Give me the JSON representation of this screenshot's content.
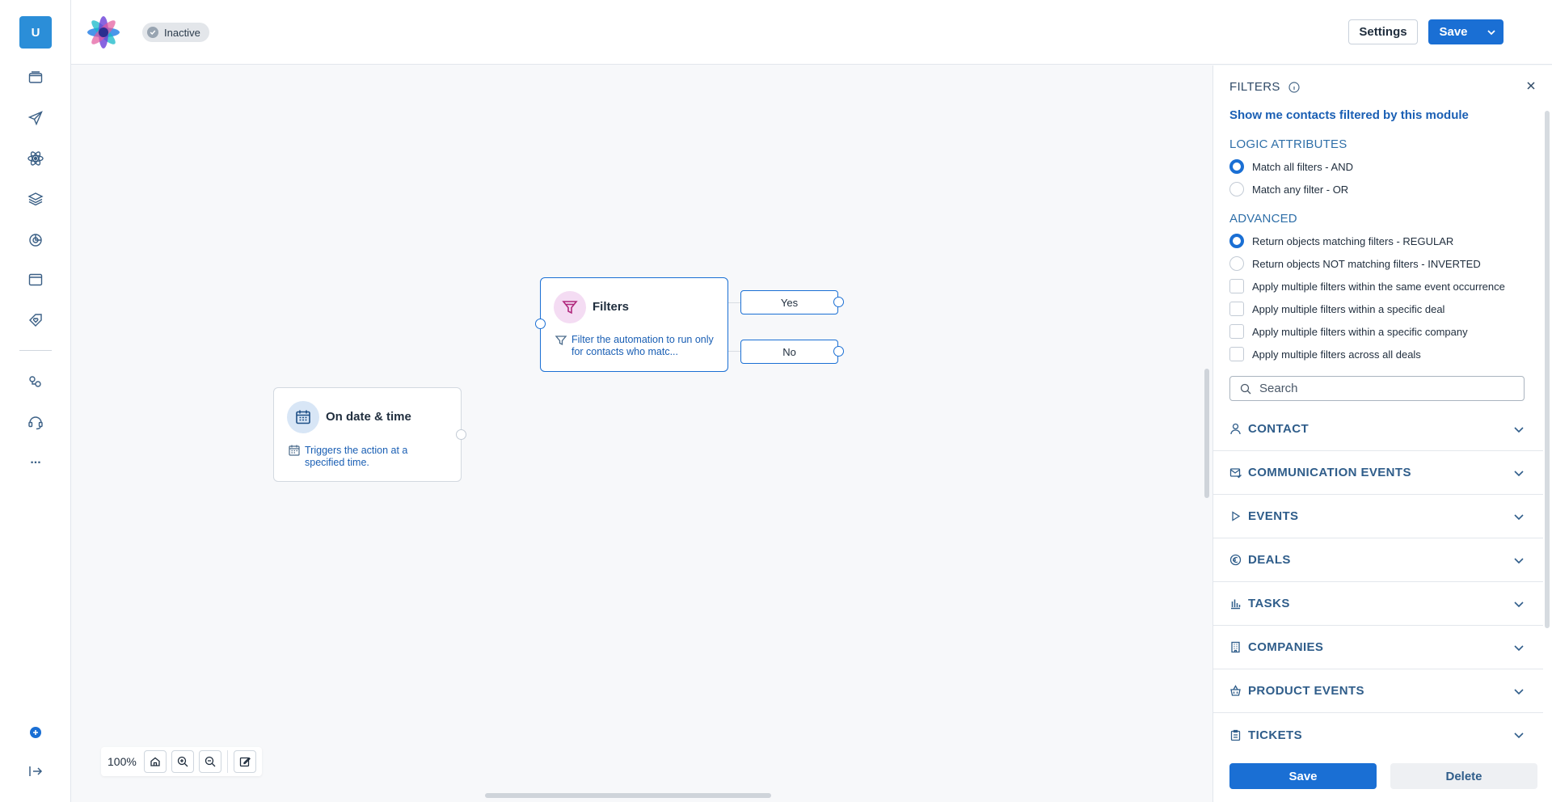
{
  "user": {
    "initial": "U"
  },
  "header": {
    "status": "Inactive",
    "settings_label": "Settings",
    "save_label": "Save"
  },
  "sidebar": {
    "items": [
      {
        "icon": "folder-icon"
      },
      {
        "icon": "send-icon"
      },
      {
        "icon": "atom-icon"
      },
      {
        "icon": "layers-icon"
      },
      {
        "icon": "pie-chart-icon"
      },
      {
        "icon": "browser-window-icon"
      },
      {
        "icon": "tag-heart-icon"
      },
      {
        "icon": "key-icon"
      },
      {
        "icon": "headset-icon"
      },
      {
        "icon": "more-icon",
        "label": "..."
      }
    ],
    "bottom": [
      {
        "icon": "add-circle-icon"
      },
      {
        "icon": "logout-icon"
      }
    ]
  },
  "canvas": {
    "filters_node": {
      "title": "Filters",
      "description": "Filter the automation to run only for contacts who matc...",
      "branches": [
        "Yes",
        "No"
      ]
    },
    "trigger_node": {
      "title": "On date & time",
      "description": "Triggers the action at a specified time."
    },
    "zoom": "100%"
  },
  "panel": {
    "title": "FILTERS",
    "contacts_link": "Show me contacts filtered by this module",
    "logic": {
      "title": "LOGIC ATTRIBUTES",
      "options": [
        "Match all filters - AND",
        "Match any filter - OR"
      ],
      "selected": 0
    },
    "advanced": {
      "title": "ADVANCED",
      "radios": [
        "Return objects matching filters - REGULAR",
        "Return objects NOT matching filters - INVERTED"
      ],
      "selected": 0,
      "checks": [
        "Apply multiple filters within the same event occurrence",
        "Apply multiple filters within a specific deal",
        "Apply multiple filters within a specific company",
        "Apply multiple filters across all deals"
      ]
    },
    "search_placeholder": "Search",
    "sections": [
      {
        "label": "CONTACT",
        "icon": "person-icon"
      },
      {
        "label": "COMMUNICATION EVENTS",
        "icon": "mail-check-icon"
      },
      {
        "label": "EVENTS",
        "icon": "play-icon"
      },
      {
        "label": "DEALS",
        "icon": "euro-icon"
      },
      {
        "label": "TASKS",
        "icon": "bar-chart-icon"
      },
      {
        "label": "COMPANIES",
        "icon": "building-icon"
      },
      {
        "label": "PRODUCT EVENTS",
        "icon": "basket-icon"
      },
      {
        "label": "TICKETS",
        "icon": "clipboard-icon"
      }
    ],
    "save_label": "Save",
    "delete_label": "Delete"
  },
  "colors": {
    "primary": "#1a6fd4",
    "link": "#1a5fb4",
    "section_title": "#2f6fa8"
  }
}
